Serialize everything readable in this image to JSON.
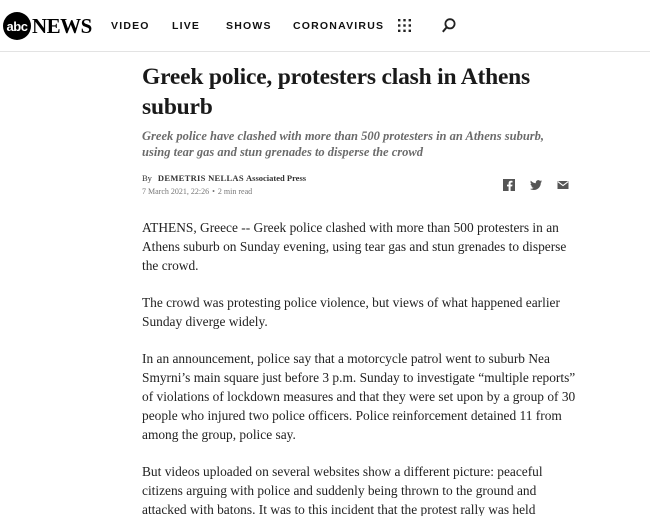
{
  "header": {
    "logo_abc": "abc",
    "logo_news": "NEWS",
    "nav": [
      "VIDEO",
      "LIVE",
      "SHOWS",
      "CORONAVIRUS"
    ],
    "icons": {
      "menu": "grid-icon",
      "search": "search-icon"
    }
  },
  "article": {
    "headline": "Greek police, protesters clash in Athens suburb",
    "dek": "Greek police have clashed with more than 500 protesters in an Athens suburb, using tear gas and stun grenades to disperse the crowd",
    "byline_by": "By",
    "author": "DEMETRIS NELLAS",
    "agency": "Associated Press",
    "date": "7 March 2021, 22:26",
    "separator": "•",
    "read_time": "2 min read",
    "share_icons": [
      "facebook-icon",
      "twitter-icon",
      "email-icon"
    ],
    "paragraphs": [
      "ATHENS, Greece -- Greek police clashed with more than 500 protesters in an Athens suburb on Sunday evening, using tear gas and stun grenades to disperse the crowd.",
      "The crowd was protesting police violence, but views of what happened earlier Sunday diverge widely.",
      "In an announcement, police say that a motorcycle patrol went to suburb Nea Smyrni’s main square just before 3 p.m. Sunday to investigate “multiple reports” of violations of lockdown measures and that they were set upon by a group of 30 people who injured two police officers. Police reinforcement detained 11 from among the group, police say.",
      "But videos uploaded on several websites show a different picture: peaceful citizens arguing with police and suddenly being thrown to the ground and attacked with batons. It was to this incident that the protest rally was held"
    ]
  },
  "colors": {
    "logo": "#000000",
    "dek": "#6b6b6b",
    "text": "#222222",
    "divider": "#e3e3e3"
  }
}
